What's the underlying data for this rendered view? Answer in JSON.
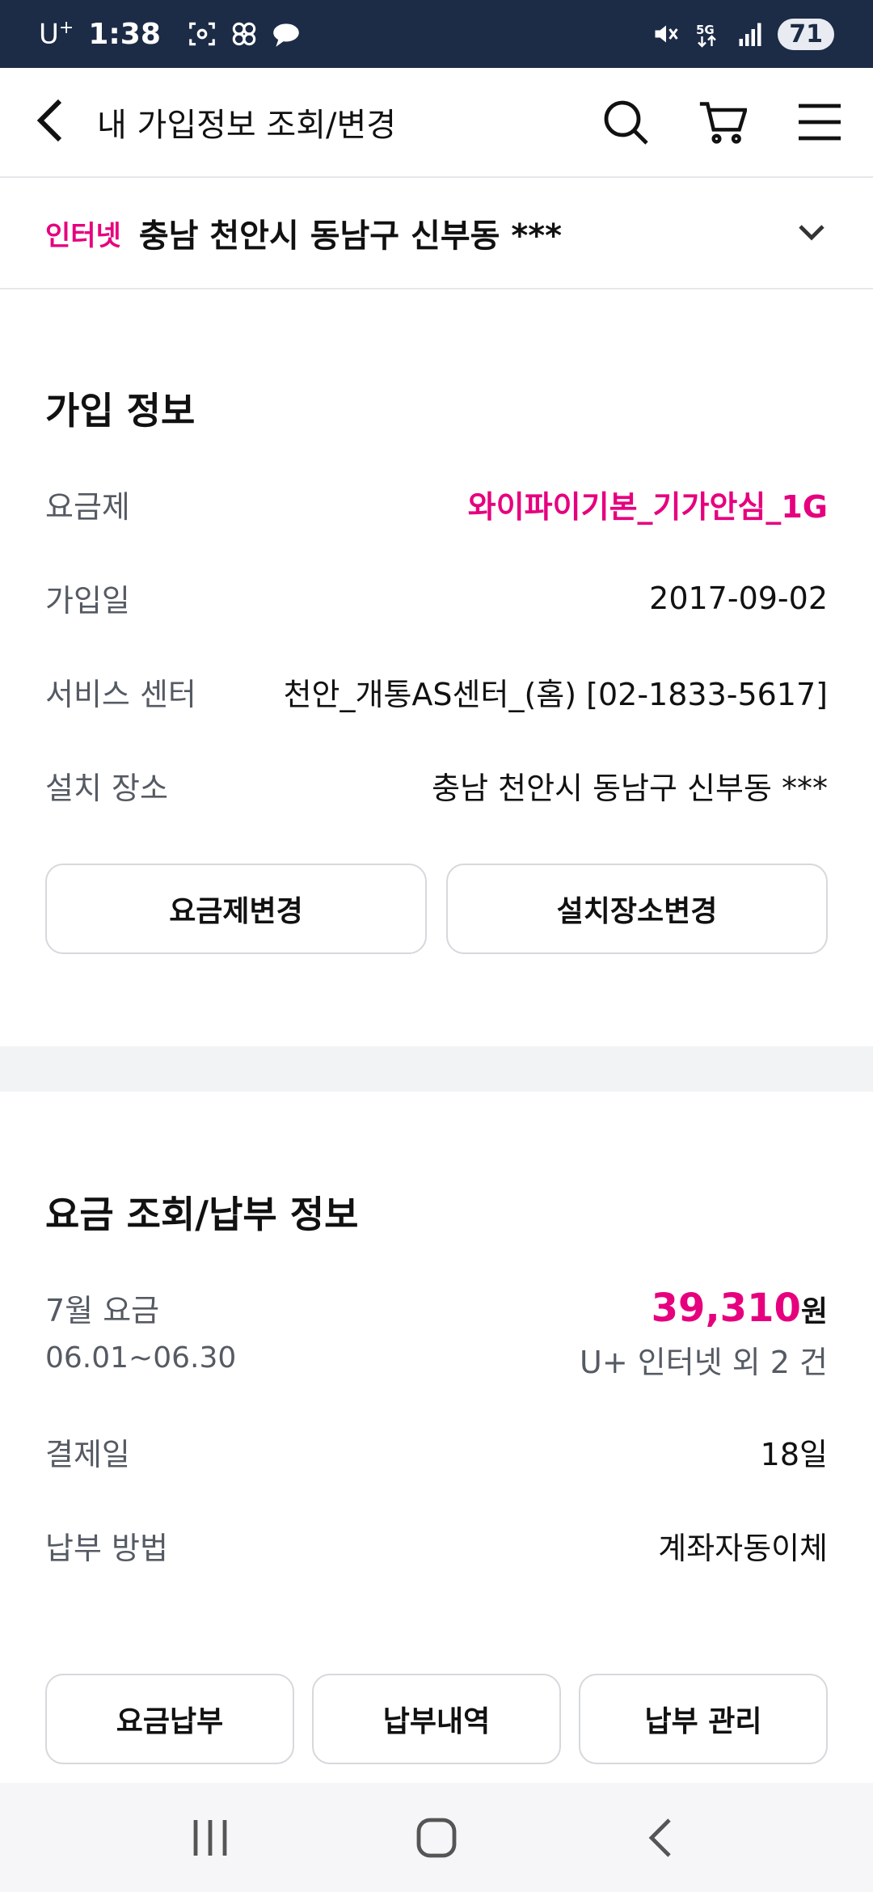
{
  "status_bar": {
    "carrier": "U",
    "carrier_sup": "+",
    "time": "1:38",
    "battery": "71",
    "network": "5G"
  },
  "header": {
    "title": "내 가입정보 조회/변경"
  },
  "selector": {
    "tag": "인터넷",
    "address": "충남 천안시 동남구 신부동 ***"
  },
  "subscription": {
    "title": "가입 정보",
    "rows": [
      {
        "label": "요금제",
        "value": "와이파이기본_기가안심_1G"
      },
      {
        "label": "가입일",
        "value": "2017-09-02"
      },
      {
        "label": "서비스 센터",
        "value": "천안_개통AS센터_(홈) [02-1833-5617]"
      },
      {
        "label": "설치 장소",
        "value": "충남 천안시 동남구 신부동 ***"
      }
    ],
    "buttons": {
      "change_plan": "요금제변경",
      "change_location": "설치장소변경"
    }
  },
  "billing": {
    "title": "요금 조회/납부 정보",
    "month_label": "7월 요금",
    "period": "06.01~06.30",
    "amount": "39,310",
    "amount_unit": "원",
    "amount_detail": "U+ 인터넷 외 2 건",
    "rows": [
      {
        "label": "결제일",
        "value": "18일"
      },
      {
        "label": "납부 방법",
        "value": "계좌자동이체"
      }
    ],
    "buttons": {
      "pay": "요금납부",
      "history": "납부내역",
      "manage": "납부 관리"
    }
  },
  "colors": {
    "accent": "#e6007e",
    "status_bar": "#1c2b46"
  }
}
